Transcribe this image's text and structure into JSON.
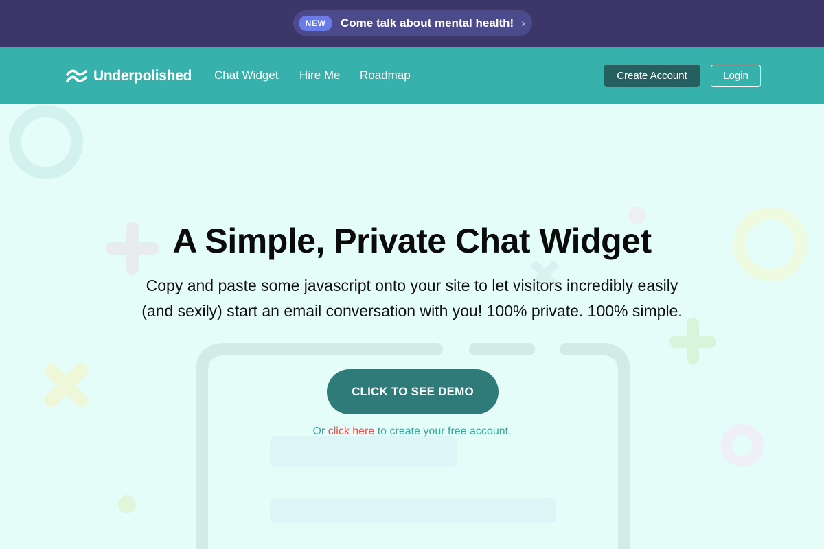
{
  "announcement": {
    "badge": "NEW",
    "text": "Come talk about mental health!",
    "chevron": "›"
  },
  "navbar": {
    "brand_name": "Underpolished",
    "brand_icon": "wave-logo-icon",
    "links": [
      {
        "label": "Chat Widget"
      },
      {
        "label": "Hire Me"
      },
      {
        "label": "Roadmap"
      }
    ],
    "create_account_label": "Create Account",
    "login_label": "Login"
  },
  "hero": {
    "title": "A Simple, Private Chat Widget",
    "subtitle_line1": "Copy and paste some javascript onto your site to let visitors incredibly easily",
    "subtitle_line2": "(and sexily) start an email conversation with you! 100% private. 100% simple.",
    "cta_label": "CLICK TO SEE DEMO",
    "note_prefix": "Or ",
    "note_link": "click here",
    "note_suffix": " to create your free account."
  },
  "colors": {
    "announcement_bg": "#3d3669",
    "navbar_bg": "#37b1ab",
    "page_bg": "#e4fdf8",
    "cta_bg": "#2e7b79",
    "link_red": "#e94a4a"
  }
}
